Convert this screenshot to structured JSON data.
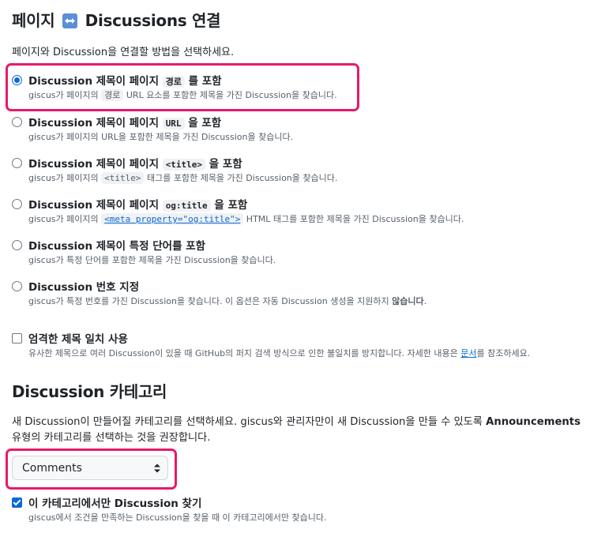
{
  "header": {
    "title_left": "페이지",
    "title_right": "Discussions 연결",
    "intro": "페이지와 Discussion을 연결할 방법을 선택하세요."
  },
  "options": [
    {
      "title_pre": "Discussion 제목이 페이지 ",
      "title_code": "경로",
      "title_post": " 를 포함",
      "desc_pre": "giscus가 페이지의 ",
      "desc_code": "경로",
      "desc_post": " URL 요소를 포함한 제목을 가진 Discussion을 찾습니다.",
      "checked": true
    },
    {
      "title_pre": "Discussion 제목이 페이지 ",
      "title_code": "URL",
      "title_post": " 을 포함",
      "desc_pre": "giscus가 페이지의 URL을 포함한 제목을 가진 Discussion을 찾습니다.",
      "checked": false
    },
    {
      "title_pre": "Discussion 제목이 페이지 ",
      "title_code": "<title>",
      "title_post": " 을 포함",
      "desc_pre": "giscus가 페이지의 ",
      "desc_code": "<title>",
      "desc_post": " 태그를 포함한 제목을 가진 Discussion을 찾습니다.",
      "checked": false
    },
    {
      "title_pre": "Discussion 제목이 페이지 ",
      "title_code": "og:title",
      "title_post": " 을 포함",
      "desc_pre": "giscus가 페이지의 ",
      "desc_link": "<meta property=\"og:title\">",
      "desc_post": " HTML 태그를 포함한 제목을 가진 Discussion을 찾습니다.",
      "checked": false
    },
    {
      "title_pre": "Discussion 제목이 특정 단어를 포함",
      "desc_pre": "giscus가 특정 단어를 포함한 제목을 가진 Discussion을 찾습니다.",
      "checked": false
    },
    {
      "title_pre": "Discussion 번호 지정",
      "desc_pre": "giscus가 특정 번호를 가진 Discussion을 찾습니다. 이 옵션은 자동 Discussion 생성을 지원하지 ",
      "desc_bold": "않습니다",
      "desc_post": ".",
      "checked": false
    }
  ],
  "strict": {
    "title": "엄격한 제목 일치 사용",
    "desc_pre": "유사한 제목으로 여러 Discussion이 있을 때 GitHub의 퍼지 검색 방식으로 인한 불일치를 방지합니다. 자세한 내용은 ",
    "desc_link": "문서",
    "desc_post": "를 참조하세요.",
    "checked": false
  },
  "category": {
    "title": "Discussion 카테고리",
    "desc_line1_pre": "새 Discussion이 만들어질 카테고리를 선택하세요. giscus와 관리자만이 새 Discussion을 만들 수 있도록 ",
    "desc_line1_bold": "Announcements",
    "desc_line2": "유형의 카테고리를 선택하는 것을 권장합니다.",
    "selected": "Comments",
    "only_title": "이 카테고리에서만 Discussion 찾기",
    "only_desc": "giscus에서 조건을 만족하는 Discussion을 찾을 때 이 카테고리에서만 찾습니다.",
    "only_checked": true
  },
  "colors": {
    "accent": "#0969da",
    "highlight": "#e8196a",
    "icon_bg": "#5b8fd6"
  }
}
